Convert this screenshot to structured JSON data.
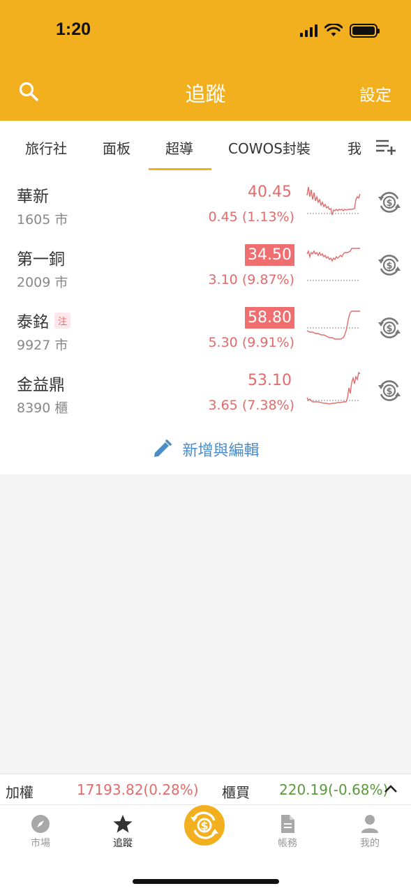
{
  "status": {
    "time": "1:20"
  },
  "header": {
    "title": "追蹤",
    "settings_label": "設定"
  },
  "tabs": [
    {
      "label": "旅行社",
      "active": false
    },
    {
      "label": "面板",
      "active": false
    },
    {
      "label": "超導",
      "active": true
    },
    {
      "label": "COWOS封裝",
      "active": false
    },
    {
      "label": "我",
      "active": false
    }
  ],
  "stocks": [
    {
      "name": "華新",
      "code": "1605 市",
      "price": "40.45",
      "change": "0.45 (1.13%)",
      "limit": false,
      "note": ""
    },
    {
      "name": "第一銅",
      "code": "2009 市",
      "price": "34.50",
      "change": "3.10 (9.87%)",
      "limit": true,
      "note": ""
    },
    {
      "name": "泰銘",
      "code": "9927 市",
      "price": "58.80",
      "change": "5.30 (9.91%)",
      "limit": true,
      "note": "注"
    },
    {
      "name": "金益鼎",
      "code": "8390 櫃",
      "price": "53.10",
      "change": "3.65 (7.38%)",
      "limit": false,
      "note": ""
    }
  ],
  "add_edit_label": "新增與編輯",
  "index_bar": {
    "taiex_label": "加權",
    "taiex_value": "17193.82(0.28%)",
    "otc_label": "櫃買",
    "otc_value": "220.19(-0.68%)"
  },
  "bottom_nav": {
    "market": "市場",
    "watchlist": "追蹤",
    "account": "帳務",
    "me": "我的"
  },
  "colors": {
    "brand": "#f2b01e",
    "up": "#e26b6b",
    "down": "#5a9a3c",
    "limit_bg": "#ef6f70",
    "link": "#4a8cc7"
  }
}
